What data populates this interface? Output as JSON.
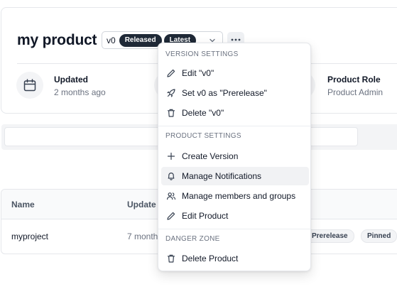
{
  "product": {
    "title": "my product",
    "version": "v0",
    "badges": [
      "Released",
      "Latest"
    ]
  },
  "stats": [
    {
      "label": "Updated",
      "value": "2 months ago",
      "icon": "calendar-icon"
    },
    {
      "label": "Product Role",
      "value": "Product Admin",
      "icon": "person-icon"
    }
  ],
  "table": {
    "headers": [
      "Name",
      "Update"
    ],
    "rows": [
      {
        "name": "myproject",
        "updated": "7 month",
        "pills": [
          "Prerelease",
          "Pinned"
        ]
      }
    ]
  },
  "menu": {
    "sections": [
      {
        "title": "VERSION SETTINGS",
        "items": [
          {
            "label": "Edit \"v0\"",
            "icon": "pencil-icon"
          },
          {
            "label": "Set v0 as \"Prerelease\"",
            "icon": "rocket-icon"
          },
          {
            "label": "Delete \"v0\"",
            "icon": "trash-icon"
          }
        ]
      },
      {
        "title": "PRODUCT SETTINGS",
        "items": [
          {
            "label": "Create Version",
            "icon": "plus-icon"
          },
          {
            "label": "Manage Notifications",
            "icon": "bell-icon"
          },
          {
            "label": "Manage members and groups",
            "icon": "users-icon"
          },
          {
            "label": "Edit Product",
            "icon": "pencil-icon"
          }
        ]
      },
      {
        "title": "DANGER ZONE",
        "items": [
          {
            "label": "Delete Product",
            "icon": "trash-icon"
          }
        ]
      }
    ]
  }
}
